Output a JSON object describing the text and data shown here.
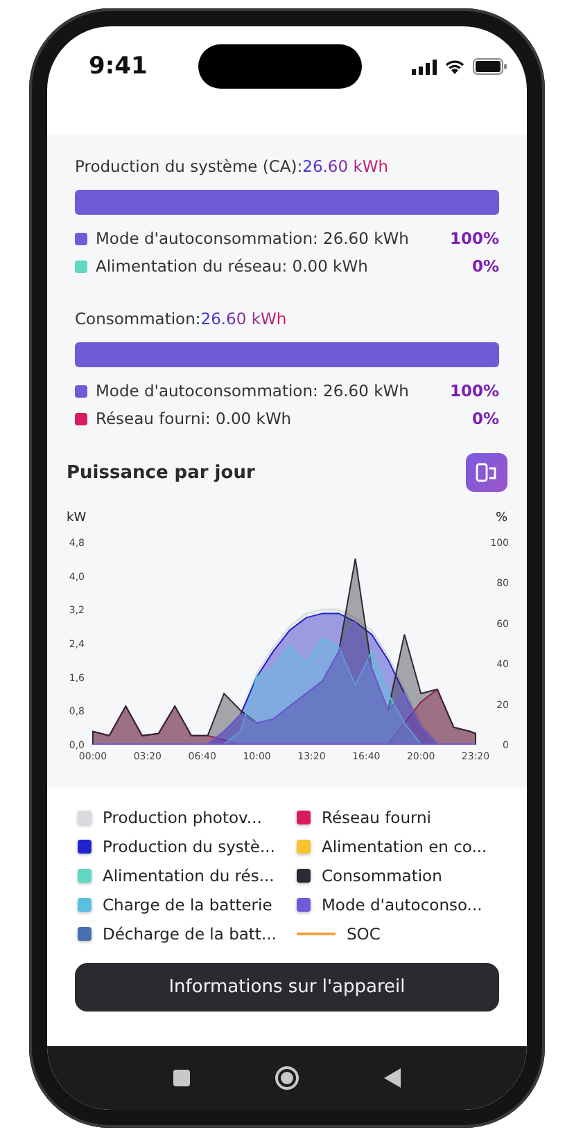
{
  "status_bar": {
    "time": "9:41"
  },
  "sections": [
    {
      "title": "Production du système (CA):",
      "total": "26.60 kWh",
      "level": 1,
      "rows": [
        {
          "label": "Mode d'autoconsommation: 26.60 kWh",
          "percent": "100%",
          "color": "#6f5bd6"
        },
        {
          "label": "Alimentation du réseau: 0.00 kWh",
          "percent": "0%",
          "color": "#5fd8c4"
        }
      ]
    },
    {
      "title": "Consommation:",
      "total": "26.60 kWh",
      "level": 1,
      "rows": [
        {
          "label": "Mode d'autoconsommation: 26.60 kWh",
          "percent": "100%",
          "color": "#6f5bd6"
        },
        {
          "label": "Réseau fourni: 0.00 kWh",
          "percent": "0%",
          "color": "#d81b60"
        }
      ]
    }
  ],
  "power": {
    "title": "Puissance par jour",
    "right_axis": {
      "label": "%",
      "ticks": [
        "100",
        "80",
        "60",
        "40",
        "20",
        "0"
      ]
    },
    "chart_data": {
      "type": "area",
      "ylabel": "kW",
      "x": [
        0,
        1,
        2,
        3,
        4,
        5,
        6,
        7,
        8,
        9,
        10,
        11,
        12,
        13,
        14,
        15,
        16,
        17,
        18,
        19,
        20,
        21,
        22,
        23,
        23.333
      ],
      "xlim": [
        0,
        23.333
      ],
      "ylim": [
        0,
        4.8
      ],
      "xticks": [
        {
          "value": 0,
          "label": "00:00"
        },
        {
          "value": 3.333,
          "label": "03:20"
        },
        {
          "value": 6.667,
          "label": "06:40"
        },
        {
          "value": 10,
          "label": "10:00"
        },
        {
          "value": 13.333,
          "label": "13:20"
        },
        {
          "value": 16.667,
          "label": "16:40"
        },
        {
          "value": 20,
          "label": "20:00"
        },
        {
          "value": 23.333,
          "label": "23:20"
        }
      ],
      "yticks": [
        {
          "value": 4.8,
          "label": "4,8"
        },
        {
          "value": 4,
          "label": "4,0"
        },
        {
          "value": 3.2,
          "label": "3,2"
        },
        {
          "value": 2.4,
          "label": "2,4"
        },
        {
          "value": 1.6,
          "label": "1,6"
        },
        {
          "value": 0.8,
          "label": "0,8"
        },
        {
          "value": 0,
          "label": "0,0"
        }
      ],
      "series": [
        {
          "name": "Production photov...",
          "color": "#d9d9de",
          "values": [
            0,
            0,
            0,
            0,
            0,
            0,
            0,
            0,
            0.3,
            0.7,
            1.7,
            2.3,
            2.8,
            3.1,
            3.2,
            3.2,
            3.0,
            2.7,
            2.1,
            1.3,
            0.5,
            0,
            0,
            0,
            0
          ]
        },
        {
          "name": "Réseau fourni",
          "color": "#d81b60",
          "values": [
            0.3,
            0.2,
            0.9,
            0.2,
            0.25,
            0.9,
            0.2,
            0.2,
            0.1,
            0,
            0,
            0,
            0,
            0,
            0,
            0,
            0,
            0,
            0,
            0.5,
            1.0,
            1.3,
            0.4,
            0.3,
            0.25
          ]
        },
        {
          "name": "Production du systè...",
          "color": "#2222cc",
          "values": [
            0,
            0,
            0,
            0,
            0,
            0,
            0,
            0,
            0.3,
            0.7,
            1.6,
            2.2,
            2.7,
            3.0,
            3.1,
            3.1,
            2.9,
            2.6,
            2.0,
            1.2,
            0.4,
            0,
            0,
            0,
            0
          ]
        },
        {
          "name": "Consommation",
          "color": "#2b2b33",
          "values": [
            0.3,
            0.2,
            0.9,
            0.2,
            0.25,
            0.9,
            0.2,
            0.2,
            1.2,
            0.8,
            0.5,
            0.6,
            0.9,
            1.2,
            1.5,
            2.2,
            4.4,
            1.8,
            0.8,
            2.6,
            1.2,
            1.3,
            0.4,
            0.3,
            0.25
          ]
        },
        {
          "name": "Charge de la batterie",
          "color": "#5bc0de",
          "values": [
            0,
            0,
            0,
            0,
            0,
            0,
            0,
            0,
            0,
            0.3,
            1.6,
            1.8,
            2.3,
            1.9,
            2.5,
            2.3,
            1.4,
            2.2,
            1.2,
            0.5,
            0,
            0,
            0,
            0,
            0
          ]
        },
        {
          "name": "Mode d'autoconso...",
          "color": "#6f5bd6",
          "values": [
            0,
            0,
            0,
            0,
            0,
            0,
            0,
            0,
            0.3,
            0.7,
            0.5,
            0.6,
            0.9,
            1.2,
            1.5,
            2.2,
            2.9,
            1.8,
            0.8,
            1.2,
            0.4,
            0,
            0,
            0,
            0
          ]
        }
      ]
    }
  },
  "legend": [
    {
      "kind": "series"
    },
    {
      "kind": "series"
    },
    {
      "kind": "series"
    },
    {
      "label": "Alimentation en co...",
      "color": "#f8c230",
      "kind": "square"
    },
    {
      "label": "Alimentation du rés...",
      "color": "#5fd8c4",
      "kind": "square"
    },
    {
      "kind": "series"
    },
    {
      "kind": "series"
    },
    {
      "kind": "series"
    },
    {
      "label": "Décharge de la batt...",
      "color": "#4a6fb0",
      "kind": "square"
    },
    {
      "label": "SOC",
      "color": "#f0a040",
      "kind": "line"
    }
  ],
  "device_button": "Informations sur l'appareil"
}
